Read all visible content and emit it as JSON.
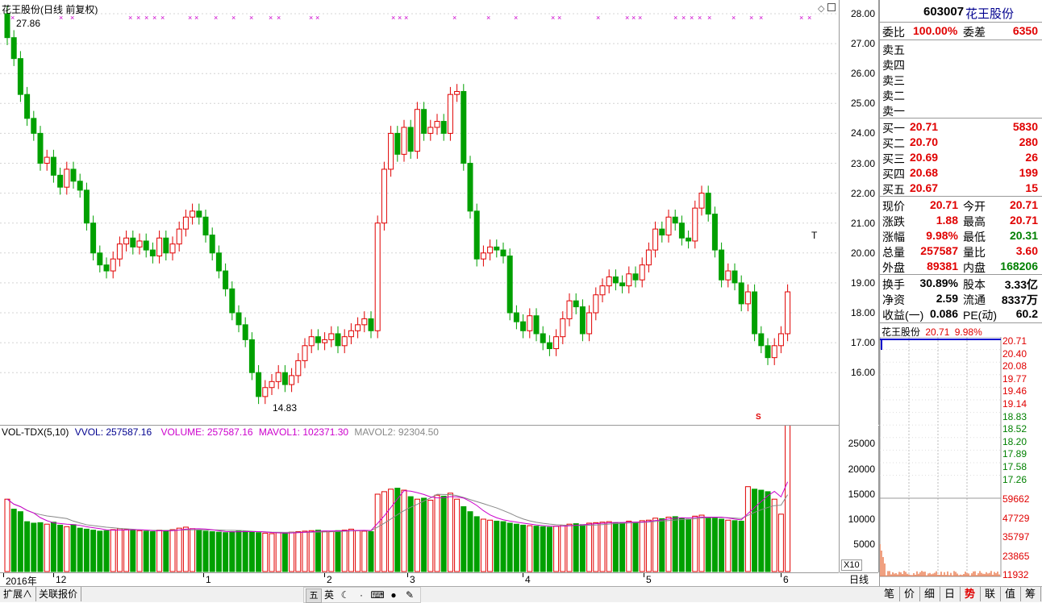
{
  "stock": {
    "code": "603007",
    "name": "花王股份"
  },
  "main_chart": {
    "title": "花王股份(日线 前复权)",
    "high_label": "27.86",
    "low_label": "14.83",
    "price_ticks": [
      "28.00",
      "27.00",
      "26.00",
      "25.00",
      "24.00",
      "23.00",
      "22.00",
      "21.00",
      "20.00",
      "19.00",
      "18.00",
      "17.00",
      "16.00"
    ],
    "marker_s": "S",
    "marker_t": "T"
  },
  "volume_chart": {
    "indicator": "VOL-TDX(5,10)",
    "vvol": "VVOL: 257587.16",
    "volume": "VOLUME: 257587.16",
    "mavol1": "MAVOL1: 102371.30",
    "mavol2": "MAVOL2: 92304.50",
    "ticks": [
      "25000",
      "20000",
      "15000",
      "10000",
      "5000"
    ],
    "unit": "X10"
  },
  "date_axis": {
    "labels": [
      "2016年",
      "12",
      "1",
      "2",
      "3",
      "4",
      "5",
      "6"
    ],
    "period": "日线"
  },
  "bottom_tabs": [
    "扩展∧",
    "关联报价"
  ],
  "ime": {
    "mode": "英"
  },
  "quote": {
    "webi_label": "委比",
    "webi": "100.00%",
    "weicha_label": "委差",
    "weicha": "6350",
    "sell": [
      {
        "label": "卖五"
      },
      {
        "label": "卖四"
      },
      {
        "label": "卖三"
      },
      {
        "label": "卖二"
      },
      {
        "label": "卖一"
      }
    ],
    "buy": [
      {
        "label": "买一",
        "price": "20.71",
        "vol": "5830"
      },
      {
        "label": "买二",
        "price": "20.70",
        "vol": "280"
      },
      {
        "label": "买三",
        "price": "20.69",
        "vol": "26"
      },
      {
        "label": "买四",
        "price": "20.68",
        "vol": "199"
      },
      {
        "label": "买五",
        "price": "20.67",
        "vol": "15"
      }
    ],
    "stats": [
      {
        "l1": "现价",
        "v1": "20.71",
        "l2": "今开",
        "v2": "20.71"
      },
      {
        "l1": "涨跌",
        "v1": "1.88",
        "l2": "最高",
        "v2": "20.71"
      },
      {
        "l1": "涨幅",
        "v1": "9.98%",
        "l2": "最低",
        "v2": "20.31"
      },
      {
        "l1": "总量",
        "v1": "257587",
        "l2": "量比",
        "v2": "3.60"
      },
      {
        "l1": "外盘",
        "v1": "89381",
        "l2": "内盘",
        "v2": "168206"
      }
    ],
    "fin": [
      {
        "l1": "换手",
        "v1": "30.89%",
        "l2": "股本",
        "v2": "3.33亿"
      },
      {
        "l1": "净资",
        "v1": "2.59",
        "l2": "流通",
        "v2": "8337万"
      },
      {
        "l1": "收益(一)",
        "v1": "0.086",
        "l2": "PE(动)",
        "v2": "60.2"
      }
    ]
  },
  "mini_chart": {
    "name": "花王股份",
    "price": "20.71",
    "pct": "9.98%",
    "price_ticks": [
      "20.71",
      "20.40",
      "20.08",
      "19.77",
      "19.46",
      "19.14",
      "18.83",
      "18.52",
      "18.20",
      "17.89",
      "17.58",
      "17.26"
    ],
    "vol_ticks": [
      "59662",
      "47729",
      "35797",
      "23865",
      "11932"
    ]
  },
  "panel_tabs": [
    "笔",
    "价",
    "细",
    "日",
    "势",
    "联",
    "值",
    "筹"
  ],
  "colors": {
    "up": "#e00000",
    "down": "#00a000",
    "ma1": "#cc00cc",
    "ma2": "#888888",
    "grid": "#cccccc"
  }
}
